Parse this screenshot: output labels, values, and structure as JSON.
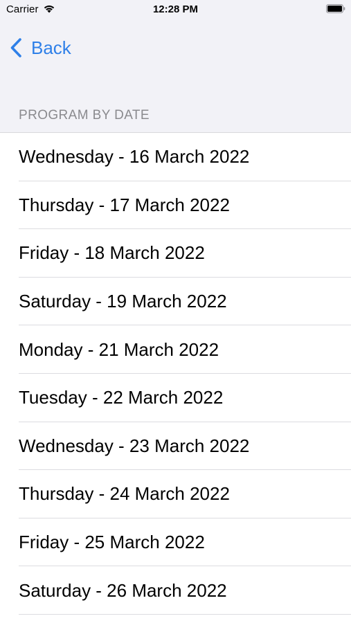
{
  "status_bar": {
    "carrier": "Carrier",
    "time": "12:28 PM"
  },
  "nav": {
    "back_label": "Back",
    "back_icon": "chevron-left-icon"
  },
  "section": {
    "header": "PROGRAM BY DATE"
  },
  "dates": [
    {
      "label": "Wednesday - 16 March 2022"
    },
    {
      "label": "Thursday - 17 March 2022"
    },
    {
      "label": "Friday - 18 March 2022"
    },
    {
      "label": "Saturday - 19 March 2022"
    },
    {
      "label": "Monday - 21 March 2022"
    },
    {
      "label": "Tuesday - 22 March 2022"
    },
    {
      "label": "Wednesday - 23 March 2022"
    },
    {
      "label": "Thursday - 24 March 2022"
    },
    {
      "label": "Friday - 25 March 2022"
    },
    {
      "label": "Saturday - 26 March 2022"
    }
  ],
  "colors": {
    "accent": "#2f80e8",
    "background": "#f2f2f7",
    "section_header": "#8a8a8e"
  }
}
